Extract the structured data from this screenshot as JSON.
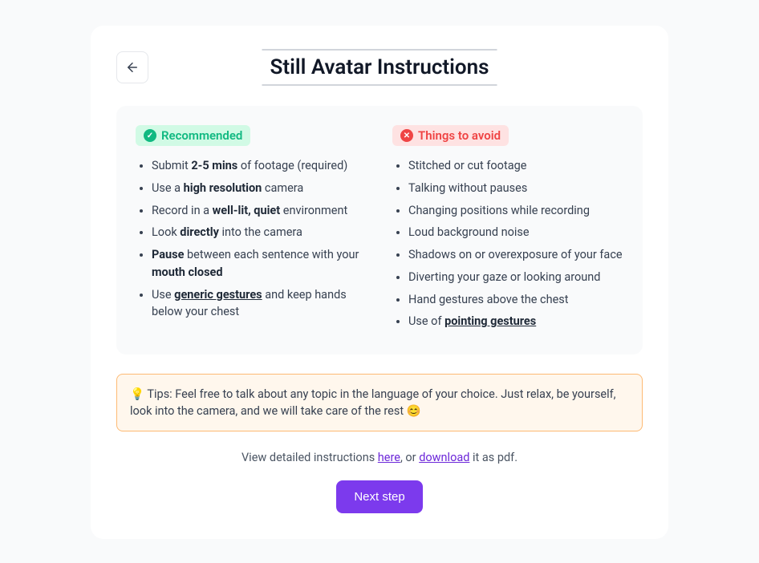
{
  "title": "Still Avatar Instructions",
  "recommended": {
    "label": "Recommended",
    "items": [
      "Submit <strong>2-5 mins</strong> of footage (required)",
      "Use a <strong>high resolution</strong> camera",
      "Record in a <strong>well-lit, quiet</strong> environment",
      "Look <strong>directly</strong> into the camera",
      "<strong>Pause</strong> between each sentence with your <strong>mouth closed</strong>",
      "Use <span class=\"ul\">generic gestures</span> and keep hands below your chest"
    ]
  },
  "avoid": {
    "label": "Things to avoid",
    "items": [
      "Stitched or cut footage",
      "Talking without pauses",
      "Changing positions while recording",
      "Loud background noise",
      "Shadows on or overexposure of your face",
      "Diverting your gaze or looking around",
      "Hand gestures above the chest",
      "Use of <span class=\"ul\">pointing gestures</span>"
    ]
  },
  "tips": "💡 Tips: Feel free to talk about any topic in the language of your choice. Just relax, be yourself, look into the camera, and we will take care of the rest 😊",
  "footer": {
    "prefix": "View detailed instructions ",
    "here": "here",
    "mid": ", or ",
    "download": "download",
    "suffix": " it as pdf."
  },
  "next_label": "Next step"
}
